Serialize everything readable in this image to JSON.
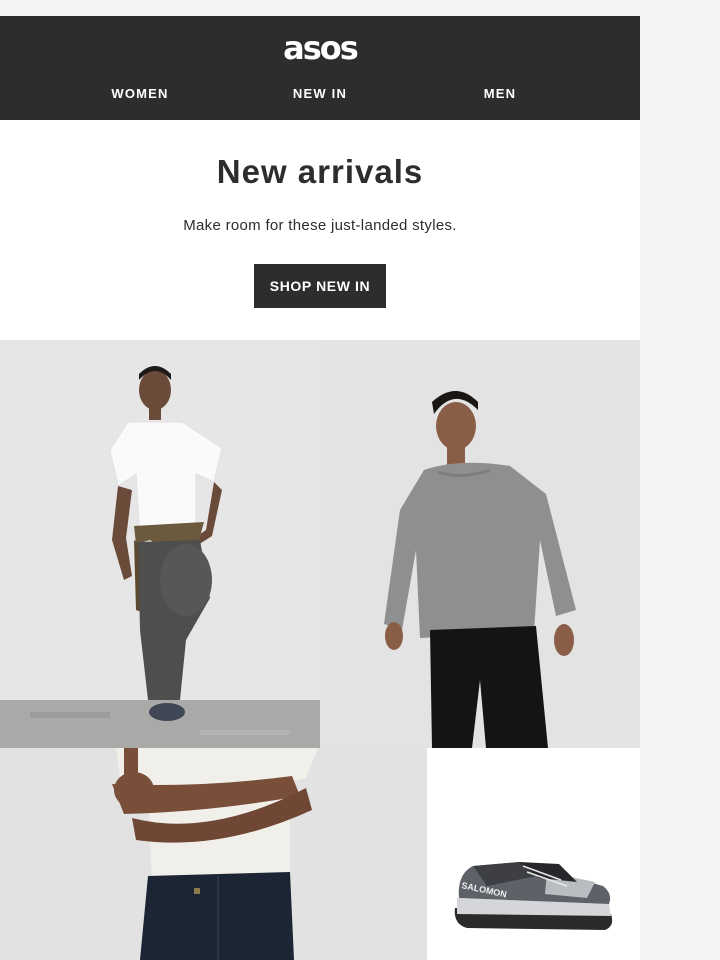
{
  "header": {
    "logo": "asos",
    "nav": [
      {
        "label": "WOMEN"
      },
      {
        "label": "NEW IN"
      },
      {
        "label": "MEN"
      }
    ]
  },
  "hero": {
    "title": "New arrivals",
    "subtitle": "Make room for these just-landed styles.",
    "cta_label": "SHOP NEW IN"
  },
  "images": [
    {
      "description_icon": "photo",
      "alt": ""
    },
    {
      "description_icon": "photo",
      "alt": ""
    },
    {
      "description_icon": "photo",
      "alt": ""
    },
    {
      "description_icon": "photo",
      "alt": ""
    }
  ],
  "product_brand_mark": "SALOMON",
  "colors": {
    "header_bg": "#2d2d2d",
    "text": "#2d2d2d",
    "page_bg": "#f4f4f4"
  }
}
